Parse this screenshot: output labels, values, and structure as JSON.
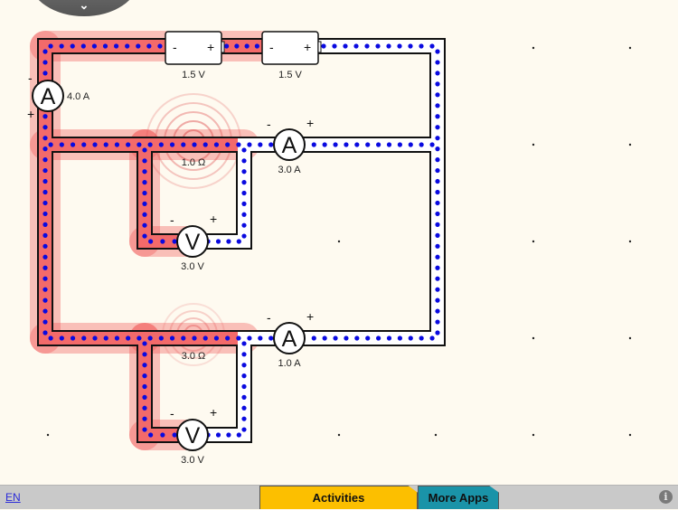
{
  "app": {
    "name": "Circuit simulator"
  },
  "colors": {
    "background": "#fefaf0",
    "wire_outline": "#111111",
    "wire_fill": "#ffffff",
    "electron_dot": "#0a0ae0",
    "heat_glow": "#f05050",
    "tab_activities": "#fcbf00",
    "tab_more_apps": "#1a93a8",
    "bottom_bar": "#c9c9c9"
  },
  "top_toggle": {
    "icon": "chevron-down-icon",
    "glyph": "⌄"
  },
  "circuit": {
    "batteries": [
      {
        "label": "1.5 V",
        "neg": "-",
        "pos": "+"
      },
      {
        "label": "1.5 V",
        "neg": "-",
        "pos": "+"
      }
    ],
    "ammeters": [
      {
        "symbol": "A",
        "reading": "4.0 A",
        "neg": "-",
        "pos": "+"
      },
      {
        "symbol": "A",
        "reading": "3.0 A",
        "neg": "-",
        "pos": "+"
      },
      {
        "symbol": "A",
        "reading": "1.0 A",
        "neg": "-",
        "pos": "+"
      }
    ],
    "resistors": [
      {
        "label": "1.0 Ω"
      },
      {
        "label": "3.0 Ω"
      }
    ],
    "voltmeters": [
      {
        "symbol": "V",
        "reading": "3.0 V",
        "neg": "-",
        "pos": "+"
      },
      {
        "symbol": "V",
        "reading": "3.0 V",
        "neg": "-",
        "pos": "+"
      }
    ]
  },
  "bottom_bar": {
    "language": "EN",
    "tabs": [
      {
        "label": "Activities"
      },
      {
        "label": "More Apps"
      }
    ],
    "info_icon": "i"
  }
}
